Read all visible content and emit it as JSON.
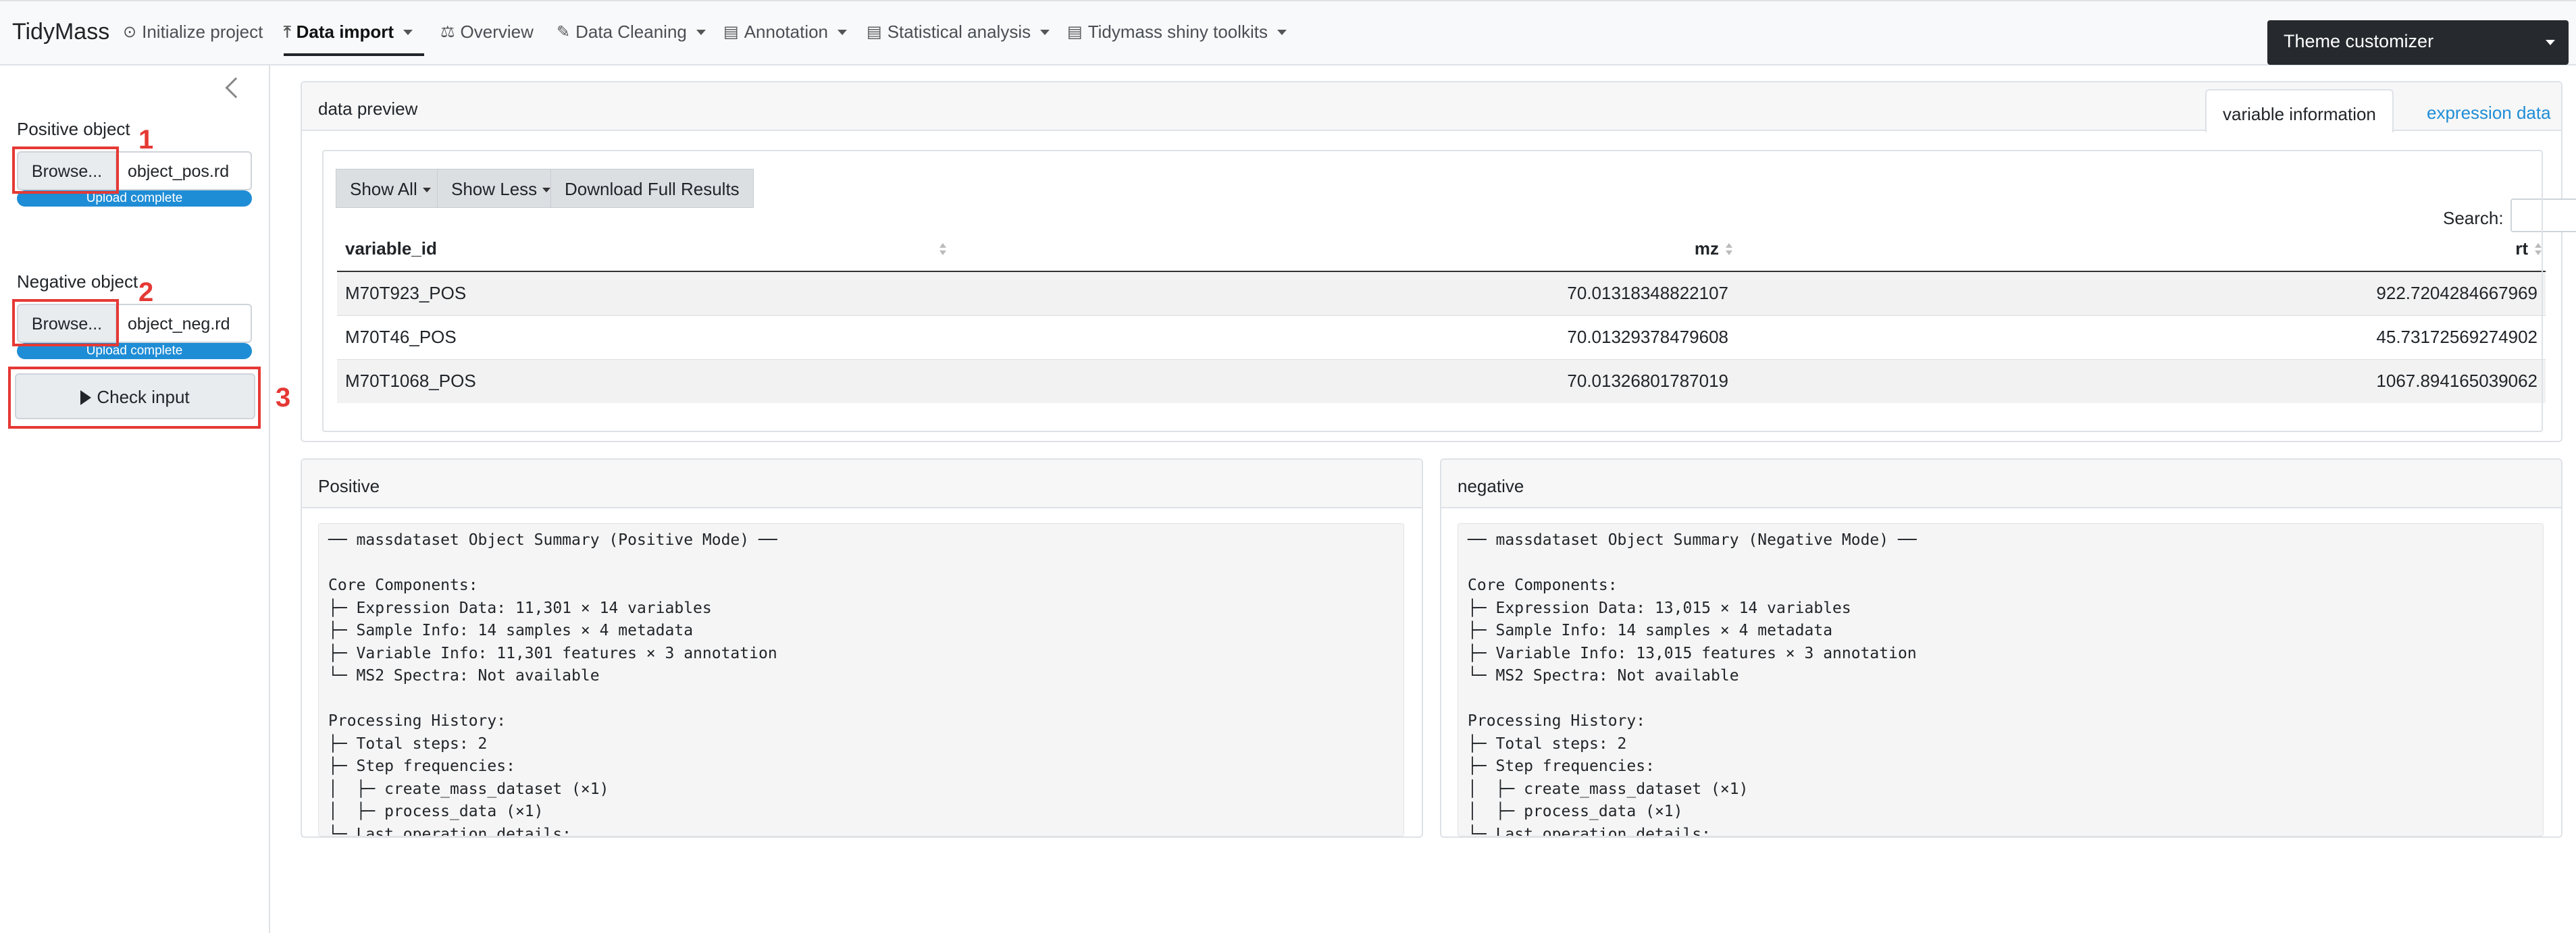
{
  "navbar": {
    "brand": "TidyMass",
    "items": [
      {
        "label": "Initialize project",
        "icon": "play-circle-icon",
        "dropdown": false,
        "active": false
      },
      {
        "label": "Data import",
        "icon": "upload-icon",
        "dropdown": true,
        "active": true
      },
      {
        "label": "Overview",
        "icon": "balance-scale-icon",
        "dropdown": false,
        "active": false
      },
      {
        "label": "Data Cleaning",
        "icon": "brush-icon",
        "dropdown": true,
        "active": false
      },
      {
        "label": "Annotation",
        "icon": "id-card-icon",
        "dropdown": true,
        "active": false
      },
      {
        "label": "Statistical analysis",
        "icon": "id-card-icon",
        "dropdown": true,
        "active": false
      },
      {
        "label": "Tidymass shiny toolkits",
        "icon": "id-card-icon",
        "dropdown": true,
        "active": false
      }
    ],
    "theme_customizer": "Theme customizer"
  },
  "sidebar": {
    "positive": {
      "label": "Positive object",
      "browse": "Browse...",
      "file": "object_pos.rd",
      "status": "Upload complete",
      "progress": 1.0,
      "step": "1"
    },
    "negative": {
      "label": "Negative object",
      "browse": "Browse...",
      "file": "object_neg.rd",
      "status": "Upload complete",
      "progress": 1.0,
      "step": "2"
    },
    "check_input": {
      "label": "Check input",
      "step": "3"
    },
    "annotation_color": "#e53935"
  },
  "preview": {
    "title": "data preview",
    "tabs": [
      {
        "label": "variable information",
        "active": true
      },
      {
        "label": "expression data",
        "active": false
      }
    ],
    "buttons": {
      "show_all": "Show All",
      "show_less": "Show Less",
      "download": "Download Full Results"
    },
    "search_label": "Search:",
    "columns": [
      "variable_id",
      "mz",
      "rt"
    ],
    "rows": [
      {
        "variable_id": "M70T923_POS",
        "mz": "70.01318348822107",
        "rt": "922.7204284667969"
      },
      {
        "variable_id": "M70T46_POS",
        "mz": "70.01329378479608",
        "rt": "45.73172569274902"
      },
      {
        "variable_id": "M70T1068_POS",
        "mz": "70.01326801787019",
        "rt": "1067.894165039062"
      }
    ]
  },
  "positive_panel": {
    "title": "Positive",
    "summary": "── massdataset Object Summary (Positive Mode) ──\n\nCore Components:\n├─ Expression Data: 11,301 × 14 variables\n├─ Sample Info: 14 samples × 4 metadata\n├─ Variable Info: 11,301 features × 3 annotation\n└─ MS2 Spectra: Not available\n\nProcessing History:\n├─ Total steps: 2\n├─ Step frequencies:\n│  ├─ create_mass_dataset (×1)\n│  ├─ process_data (×1)\n└─ Last operation details:"
  },
  "negative_panel": {
    "title": "negative",
    "summary": "── massdataset Object Summary (Negative Mode) ──\n\nCore Components:\n├─ Expression Data: 13,015 × 14 variables\n├─ Sample Info: 14 samples × 4 metadata\n├─ Variable Info: 13,015 features × 3 annotation\n└─ MS2 Spectra: Not available\n\nProcessing History:\n├─ Total steps: 2\n├─ Step frequencies:\n│  ├─ create_mass_dataset (×1)\n│  ├─ process_data (×1)\n└─ Last operation details:"
  }
}
